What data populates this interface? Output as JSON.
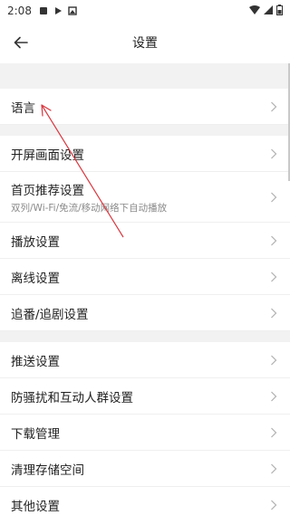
{
  "status_bar": {
    "time": "2:08",
    "icons": [
      "sim-icon",
      "play-icon",
      "image-icon"
    ],
    "right_icons": [
      "wifi-icon",
      "signal-icon",
      "battery-icon"
    ]
  },
  "header": {
    "title": "设置",
    "back_icon": "arrow-left-icon"
  },
  "settings": {
    "language": "语言",
    "startup_screen": "开屏画面设置",
    "home_recommend": "首页推荐设置",
    "home_recommend_sub": "双列/Wi-Fi/免流/移动网络下自动播放",
    "playback": "播放设置",
    "offline": "离线设置",
    "follow": "追番/追剧设置",
    "push": "推送设置",
    "anti_harass": "防骚扰和互动人群设置",
    "download": "下载管理",
    "storage": "清理存储空间",
    "other": "其他设置"
  },
  "colors": {
    "annotation_arrow": "#d9363e",
    "background": "#f2f2f2",
    "chevron": "#b0b0b0"
  }
}
